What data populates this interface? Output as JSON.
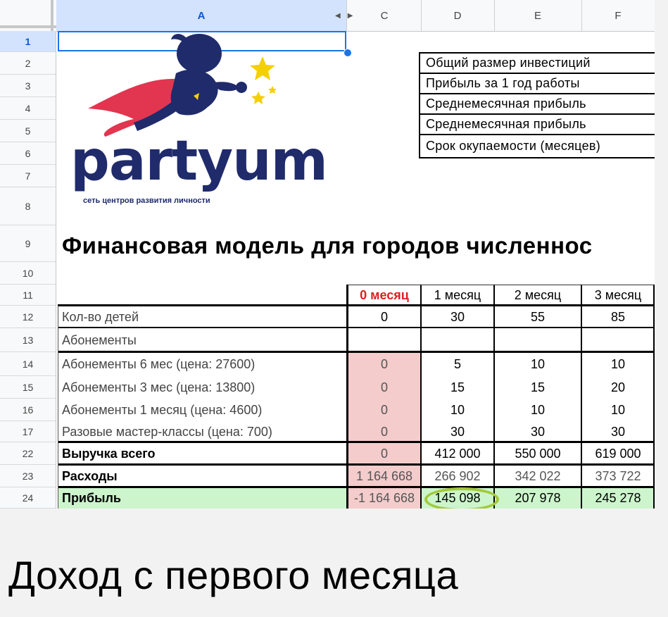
{
  "columns": [
    "A",
    "C",
    "D",
    "E",
    "F"
  ],
  "rows": [
    "1",
    "2",
    "3",
    "4",
    "5",
    "6",
    "7",
    "8",
    "9",
    "10",
    "11",
    "12",
    "13",
    "14",
    "15",
    "16",
    "17",
    "22",
    "23",
    "24"
  ],
  "logo": {
    "word": "partyum",
    "tagline": "сеть центров развития личности"
  },
  "summary": [
    "Общий размер инвестиций",
    "Прибыль  за 1 год работы",
    "Среднемесячная прибыль",
    "Среднемесячная прибыль",
    "Срок окупаемости (месяцев)"
  ],
  "title": "Финансовая модель для городов численнос",
  "table": {
    "headers": [
      "0 месяц",
      "1 месяц",
      "2 месяц",
      "3 месяц"
    ],
    "rows": [
      {
        "label": "Кол-во детей",
        "values": [
          "0",
          "30",
          "55",
          "85"
        ]
      },
      {
        "label": "Абонементы",
        "values": []
      },
      {
        "label": "Абонементы 6 мес (цена: 27600)",
        "values": [
          "0",
          "5",
          "10",
          "10"
        ]
      },
      {
        "label": "Абонементы 3 мес (цена: 13800)",
        "values": [
          "0",
          "15",
          "15",
          "20"
        ]
      },
      {
        "label": "Абонементы 1 месяц (цена: 4600)",
        "values": [
          "0",
          "10",
          "10",
          "10"
        ]
      },
      {
        "label": "Разовые мастер-классы (цена: 700)",
        "values": [
          "0",
          "30",
          "30",
          "30"
        ]
      },
      {
        "label": "Выручка всего",
        "values": [
          "0",
          "412 000",
          "550 000",
          "619 000"
        ]
      },
      {
        "label": "Расходы",
        "values": [
          "1 164 668",
          "266 902",
          "342 022",
          "373 722"
        ]
      },
      {
        "label": "Прибыль",
        "values": [
          "-1 164 668",
          "145 098",
          "207 978",
          "245 278"
        ]
      }
    ]
  },
  "caption": "Доход с первого месяца",
  "colors": {
    "selection": "#1a73e8",
    "pink": "#f4cccc",
    "green": "#ccf5cc",
    "highlight": "#a2c93a",
    "logo": "#1f2b6b",
    "cape": "#e2354f",
    "star": "#f5d000"
  }
}
